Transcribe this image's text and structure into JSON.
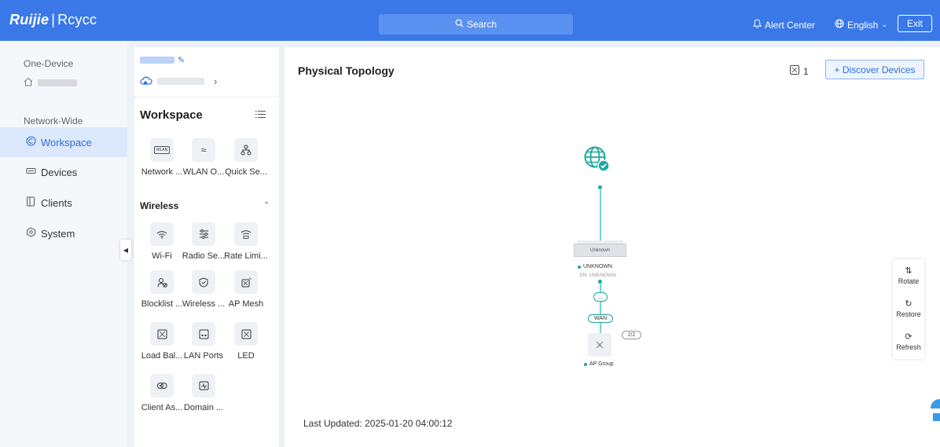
{
  "header": {
    "brand": "Ruijie",
    "product": "Rcycc",
    "search_label": "Search",
    "alert_center": "Alert Center",
    "language": "English",
    "exit_label": "Exit"
  },
  "leftnav": {
    "one_device_label": "One-Device",
    "network_wide_label": "Network-Wide",
    "items": [
      {
        "label": "Workspace",
        "icon": "workspace-icon"
      },
      {
        "label": "Devices",
        "icon": "devices-icon"
      },
      {
        "label": "Clients",
        "icon": "clients-icon"
      },
      {
        "label": "System",
        "icon": "system-icon"
      }
    ]
  },
  "workspace": {
    "title": "Workspace",
    "top_tiles": [
      {
        "label": "Network ...",
        "icon": "wlan-icon"
      },
      {
        "label": "WLAN O...",
        "icon": "wlan-optimize-icon"
      },
      {
        "label": "Quick Se...",
        "icon": "quick-setup-icon"
      }
    ],
    "wireless_header": "Wireless",
    "wireless_tiles": [
      {
        "label": "Wi-Fi",
        "icon": "wifi-icon"
      },
      {
        "label": "Radio Se...",
        "icon": "radio-settings-icon"
      },
      {
        "label": "Rate Limi...",
        "icon": "rate-limit-icon"
      },
      {
        "label": "Blocklist ...",
        "icon": "blocklist-icon"
      },
      {
        "label": "Wireless ...",
        "icon": "wireless-security-icon"
      },
      {
        "label": "AP Mesh",
        "icon": "ap-mesh-icon"
      },
      {
        "label": "Load Bal...",
        "icon": "load-balancing-icon"
      },
      {
        "label": "LAN Ports",
        "icon": "lan-ports-icon"
      },
      {
        "label": "LED",
        "icon": "led-icon"
      },
      {
        "label": "Client As...",
        "icon": "client-association-icon"
      },
      {
        "label": "Domain ...",
        "icon": "domain-icon"
      }
    ]
  },
  "topology": {
    "title": "Physical Topology",
    "count": "1",
    "discover_label": "+ Discover Devices",
    "switch_label": "Unknown",
    "device_name": "UNKNOWN",
    "device_sn": "SN: UNKNOWN",
    "link_label": "...",
    "wan_label": "WAN",
    "ap_count": "2/2",
    "ap_group_label": "AP Group",
    "last_updated": "Last Updated: 2025-01-20 04:00:12",
    "tools": [
      {
        "label": "Rotate",
        "icon": "rotate-icon"
      },
      {
        "label": "Restore",
        "icon": "restore-icon"
      },
      {
        "label": "Refresh",
        "icon": "refresh-icon"
      }
    ]
  },
  "colors": {
    "header_bg": "#3a78e8",
    "accent": "#2b6de0",
    "teal": "#1aa7a0",
    "active_nav_bg": "#dce8fb"
  }
}
